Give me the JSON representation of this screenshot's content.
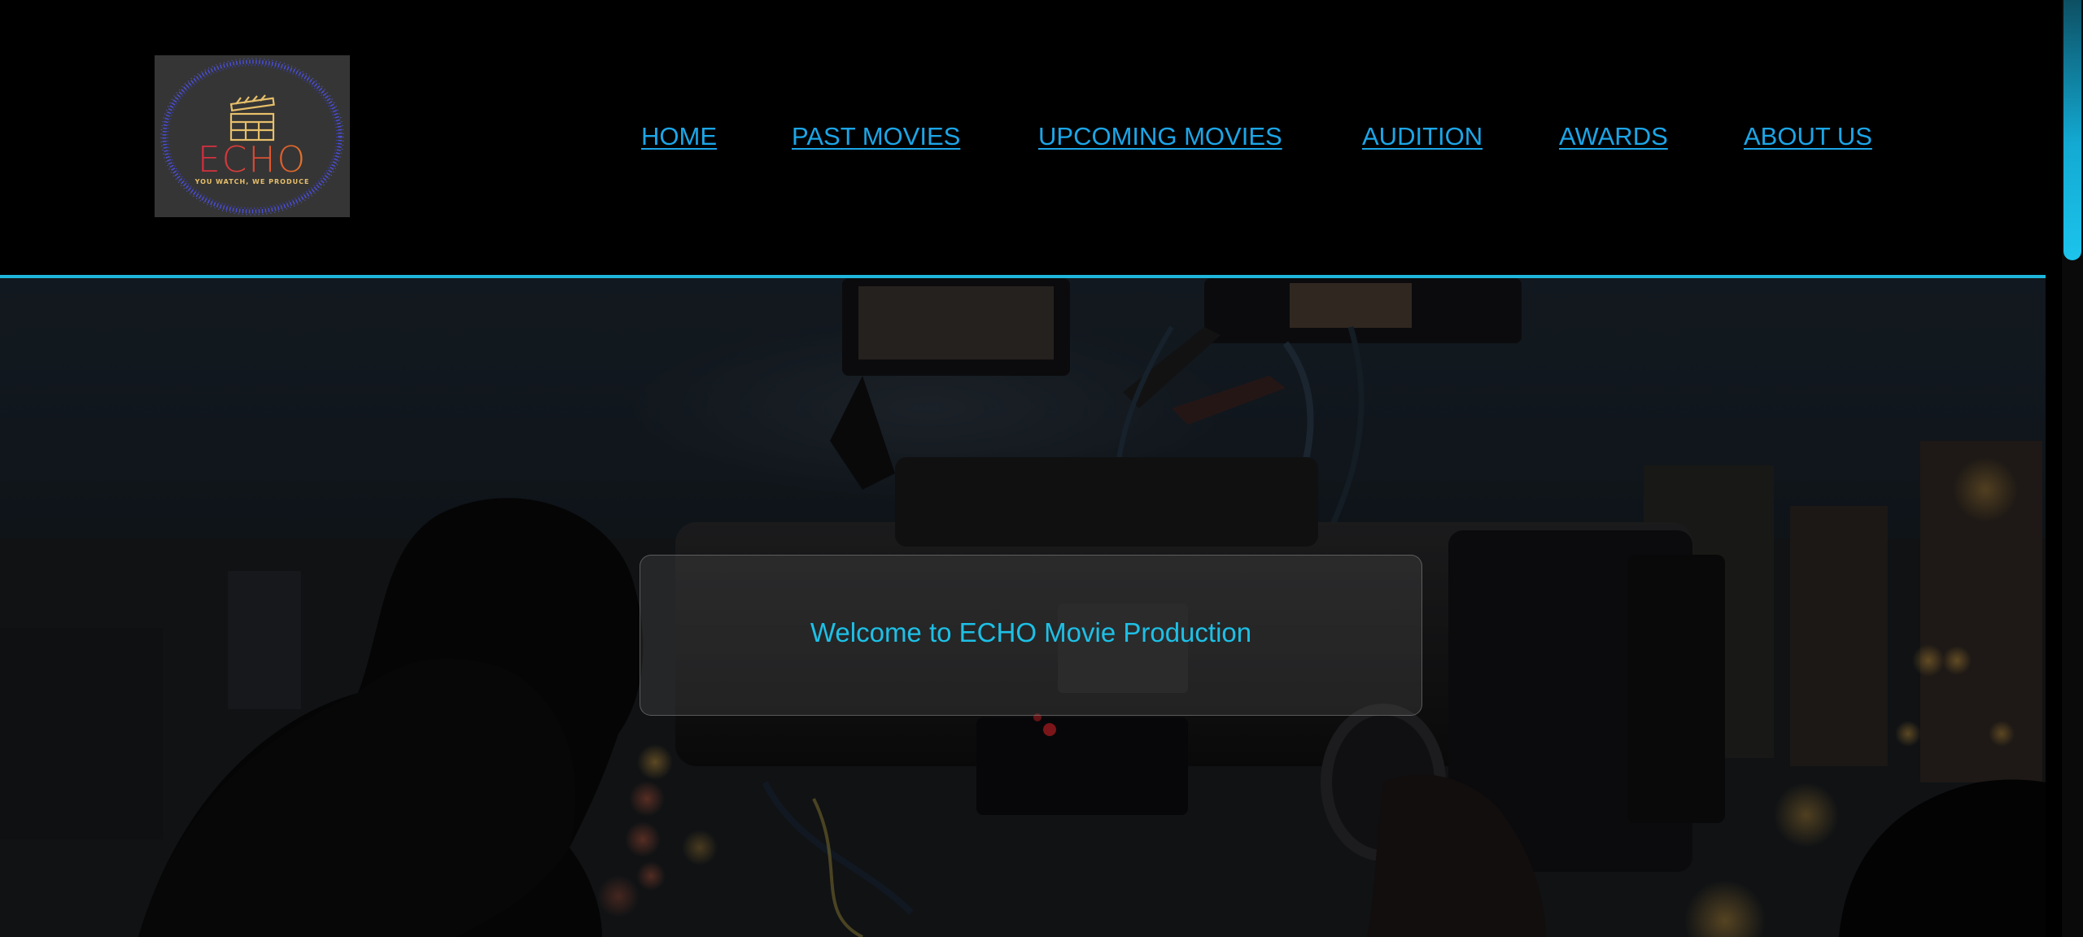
{
  "logo": {
    "word": "ECHO",
    "tagline": "YOU WATCH, WE PRODUCE",
    "icon": "clapperboard-icon",
    "colors": {
      "ring": "#4b4fe0",
      "word": "#d63a3a",
      "clapper": "#e7bf6a"
    }
  },
  "nav": {
    "items": [
      {
        "label": "HOME"
      },
      {
        "label": "PAST MOVIES"
      },
      {
        "label": "UPCOMING MOVIES"
      },
      {
        "label": "AUDITION"
      },
      {
        "label": "AWARDS"
      },
      {
        "label": "ABOUT US"
      }
    ]
  },
  "hero": {
    "background_image": "cinematographer-with-camera-rig-at-night",
    "welcome": "Welcome to ECHO Movie Production"
  },
  "colors": {
    "accent": "#1fb6dc",
    "nav_link": "#1ca6e8",
    "welcome_text": "#1ec0e6",
    "page_background": "#000000"
  }
}
